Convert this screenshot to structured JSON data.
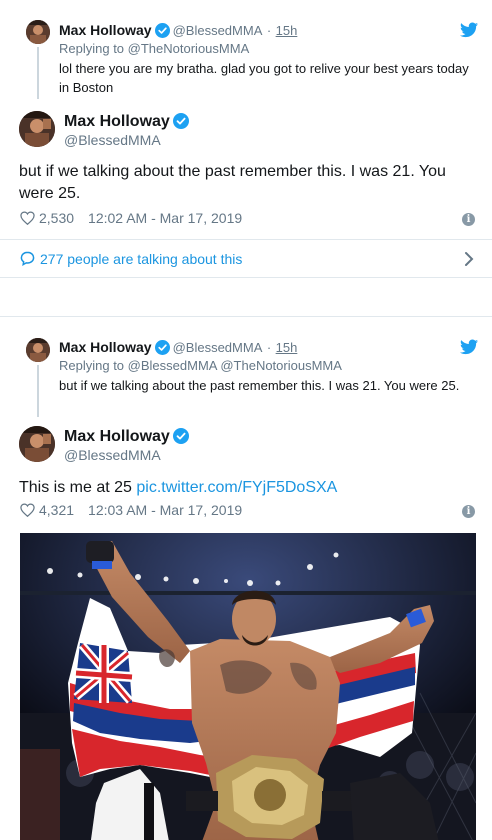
{
  "tweets": [
    {
      "parent": {
        "author_name": "Max Holloway",
        "author_handle": "@BlessedMMA",
        "separator": "·",
        "time_ago": "15h",
        "replying_to_label": "Replying to",
        "replying_to": "@TheNotoriousMMA",
        "text": "lol there you are my bratha. glad you got to relive your best years today in Boston"
      },
      "main": {
        "author_name": "Max Holloway",
        "author_handle": "@BlessedMMA",
        "text": "but if we talking about the past remember this. I was 21. You were 25.",
        "likes": "2,530",
        "timestamp": "12:02 AM - Mar 17, 2019"
      },
      "conversation_link": "277 people are talking about this"
    },
    {
      "parent": {
        "author_name": "Max Holloway",
        "author_handle": "@BlessedMMA",
        "separator": "·",
        "time_ago": "15h",
        "replying_to_label": "Replying to",
        "replying_to": "@BlessedMMA @TheNotoriousMMA",
        "text": "but if we talking about the past remember this. I was 21. You were 25."
      },
      "main": {
        "author_name": "Max Holloway",
        "author_handle": "@BlessedMMA",
        "text": "This is me at 25",
        "link": "pic.twitter.com/FYjF5DoSXA",
        "likes": "4,321",
        "timestamp": "12:03 AM - Mar 17, 2019"
      }
    }
  ],
  "colors": {
    "link": "#1b95e0",
    "muted": "#657786",
    "text": "#14171a",
    "verified": "#1da1f2",
    "divider": "#e1e8ed"
  },
  "icons": [
    "verified-badge-icon",
    "twitter-bird-icon",
    "heart-icon",
    "info-icon",
    "speech-bubble-icon",
    "chevron-right-icon"
  ]
}
